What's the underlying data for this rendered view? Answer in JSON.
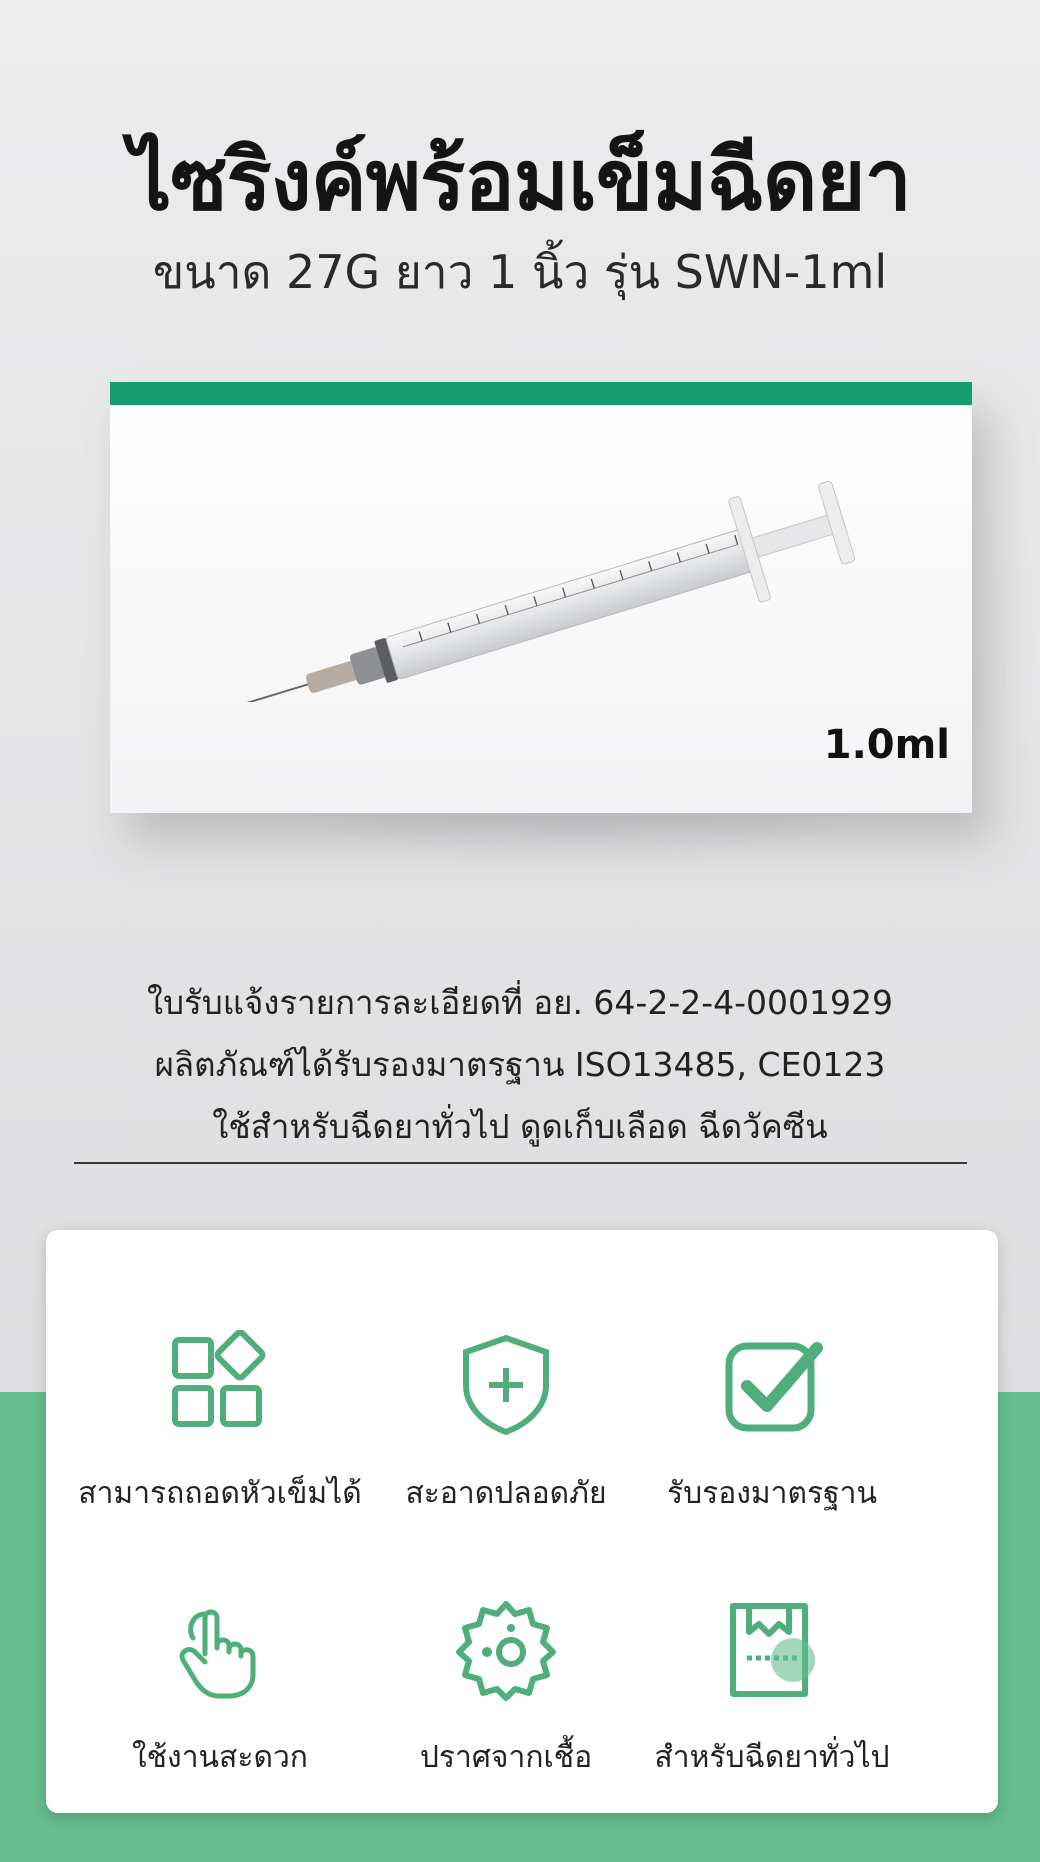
{
  "header": {
    "title": "ไซริงค์พร้อมเข็มฉีดยา",
    "subtitle": "ขนาด 27G ยาว 1 นิ้ว รุ่น SWN-1ml"
  },
  "product": {
    "volume_label": "1.0ml",
    "accent_color": "#179c6f"
  },
  "info": {
    "line1": "ใบรับแจ้งรายการละเอียดที่   อย. 64-2-2-4-0001929",
    "line2": "ผลิตภัณฑ์ได้รับรองมาตรฐาน ISO13485, CE0123",
    "line3": "ใช้สำหรับฉีดยาทั่วไป ดูดเก็บเลือด ฉีดวัคซีน"
  },
  "features": [
    {
      "label": "สามารถถอดหัวเข็มได้",
      "icon": "modules-icon"
    },
    {
      "label": "สะอาดปลอดภัย",
      "icon": "shield-plus-icon"
    },
    {
      "label": "รับรองมาตรฐาน",
      "icon": "check-box-icon"
    },
    {
      "label": "ใช้งานสะดวก",
      "icon": "hand-tap-icon"
    },
    {
      "label": "ปราศจากเชื้อ",
      "icon": "virus-icon"
    },
    {
      "label": "สำหรับฉีดยาทั่วไป",
      "icon": "package-icon"
    }
  ],
  "colors": {
    "green": "#66bd8f",
    "icon_green": "#4fae7c"
  }
}
